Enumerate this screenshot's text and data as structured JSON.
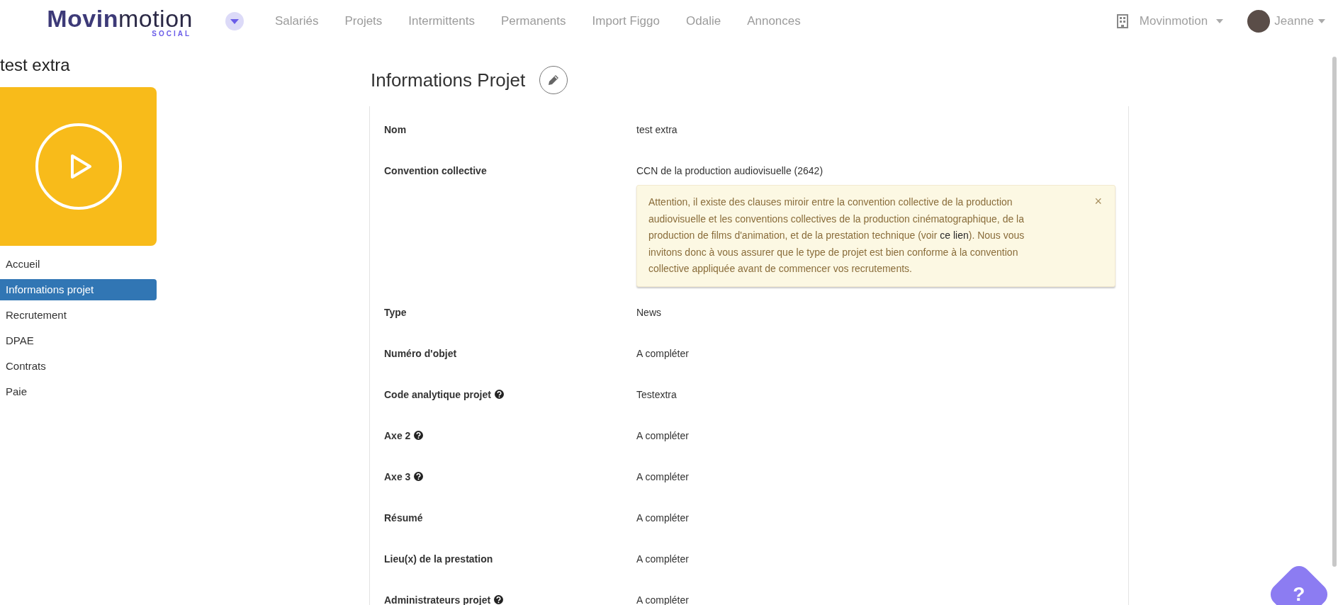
{
  "header": {
    "logo": {
      "bold": "Movin",
      "light": "motion",
      "tagline": "SOCIAL"
    },
    "nav": [
      {
        "label": "Salariés"
      },
      {
        "label": "Projets"
      },
      {
        "label": "Intermittents"
      },
      {
        "label": "Permanents"
      },
      {
        "label": "Import Figgo"
      },
      {
        "label": "Odalie"
      },
      {
        "label": "Annonces"
      }
    ],
    "company": "Movinmotion",
    "user": "Jeanne"
  },
  "sidebar": {
    "title": "test extra",
    "items": [
      {
        "label": "Accueil",
        "selected": false
      },
      {
        "label": "Informations projet",
        "selected": true
      },
      {
        "label": "Recrutement",
        "selected": false
      },
      {
        "label": "DPAE",
        "selected": false
      },
      {
        "label": "Contrats",
        "selected": false
      },
      {
        "label": "Paie",
        "selected": false
      }
    ]
  },
  "main": {
    "title": "Informations Projet",
    "fields": [
      {
        "label": "Nom",
        "value": "test extra",
        "help": false
      },
      {
        "label": "Convention collective",
        "value": "CCN de la production audiovisuelle (2642)",
        "help": false,
        "alert": {
          "before": "Attention, il existe des clauses miroir entre la convention collective de la production audiovisuelle et les conventions collectives de la production cinématographique, de la production de films d'animation, et de la prestation technique (voir ",
          "link": "ce lien",
          "after": "). Nous vous invitons donc à vous assurer que le type de projet est bien conforme à la convention collective appliquée avant de commencer vos recrutements.",
          "close": "×"
        }
      },
      {
        "label": "Type",
        "value": "News",
        "help": false
      },
      {
        "label": "Numéro d'objet",
        "value": "A compléter",
        "help": false
      },
      {
        "label": "Code analytique projet",
        "value": "Testextra",
        "help": true
      },
      {
        "label": "Axe 2",
        "value": "A compléter",
        "help": true
      },
      {
        "label": "Axe 3",
        "value": "A compléter",
        "help": true
      },
      {
        "label": "Résumé",
        "value": "A compléter",
        "help": false
      },
      {
        "label": "Lieu(x) de la prestation",
        "value": "A compléter",
        "help": false
      },
      {
        "label": "Administrateurs projet",
        "value": "A compléter",
        "help": true
      }
    ]
  },
  "help_button": {
    "label": "?"
  }
}
